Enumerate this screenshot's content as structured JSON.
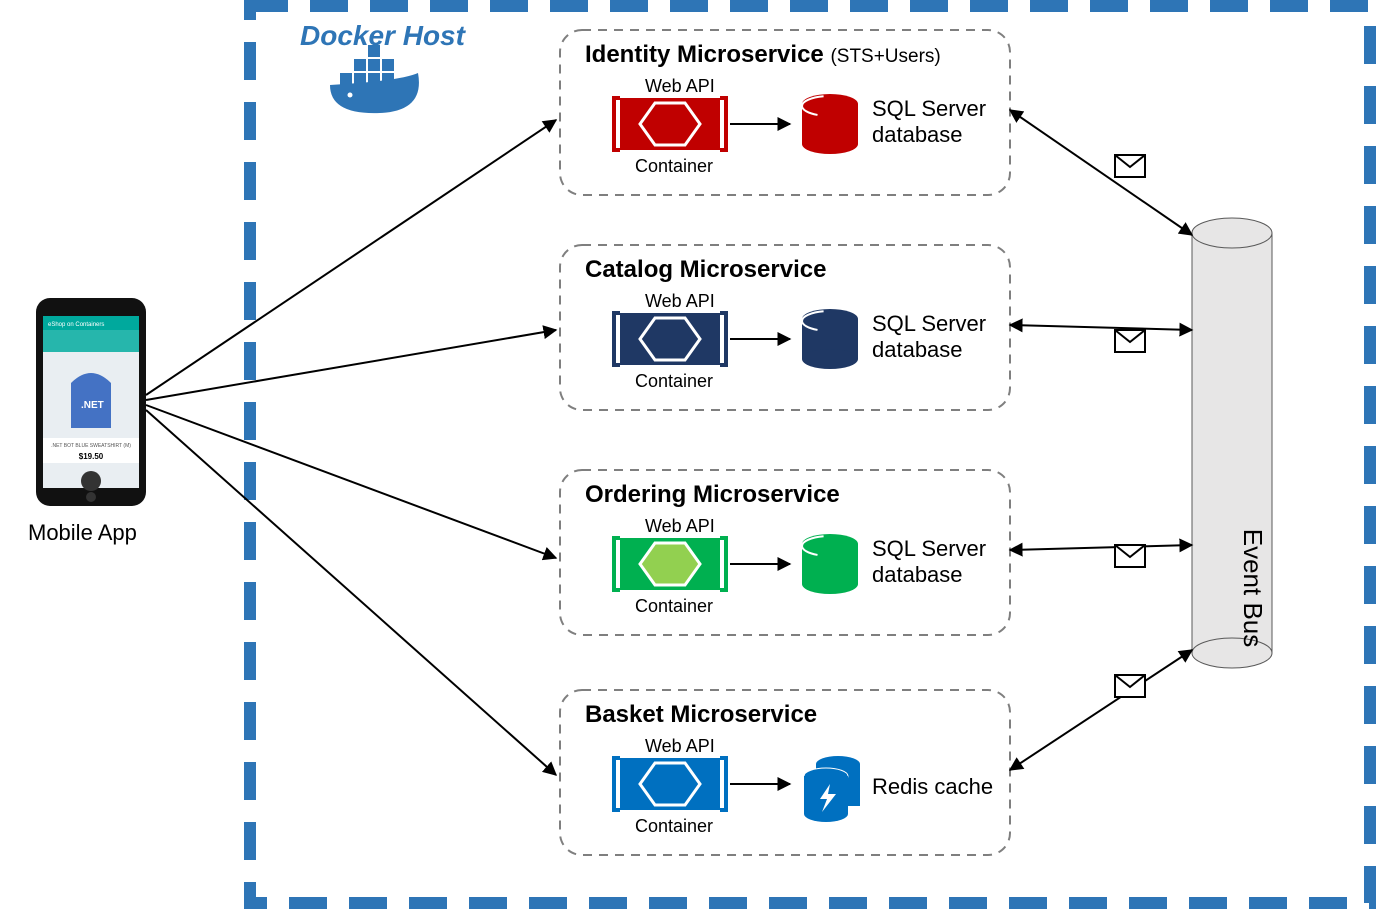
{
  "mobile_label": "Mobile App",
  "docker_label": "Docker Host",
  "event_bus_label": "Event Bus",
  "phone": {
    "title": "eShop on Containers",
    "product": ".NET BOT BLUE SWEATSHIRT (M)",
    "price": "$19.50"
  },
  "services": [
    {
      "title": "Identity Microservice",
      "suffix": "(STS+Users)",
      "api_label": "Web API",
      "container_label": "Container",
      "store": "SQL Server database",
      "color": "#c00000",
      "bg": "#c00000"
    },
    {
      "title": "Catalog Microservice",
      "suffix": "",
      "api_label": "Web API",
      "container_label": "Container",
      "store": "SQL Server database",
      "color": "#1f3864",
      "bg": "#1f3864"
    },
    {
      "title": "Ordering Microservice",
      "suffix": "",
      "api_label": "Web API",
      "container_label": "Container",
      "store": "SQL Server database",
      "color": "#00b050",
      "bg": "#00b050"
    },
    {
      "title": "Basket Microservice",
      "suffix": "",
      "api_label": "Web API",
      "container_label": "Container",
      "store": "Redis cache",
      "color": "#0070c0",
      "bg": "#0070c0"
    }
  ]
}
